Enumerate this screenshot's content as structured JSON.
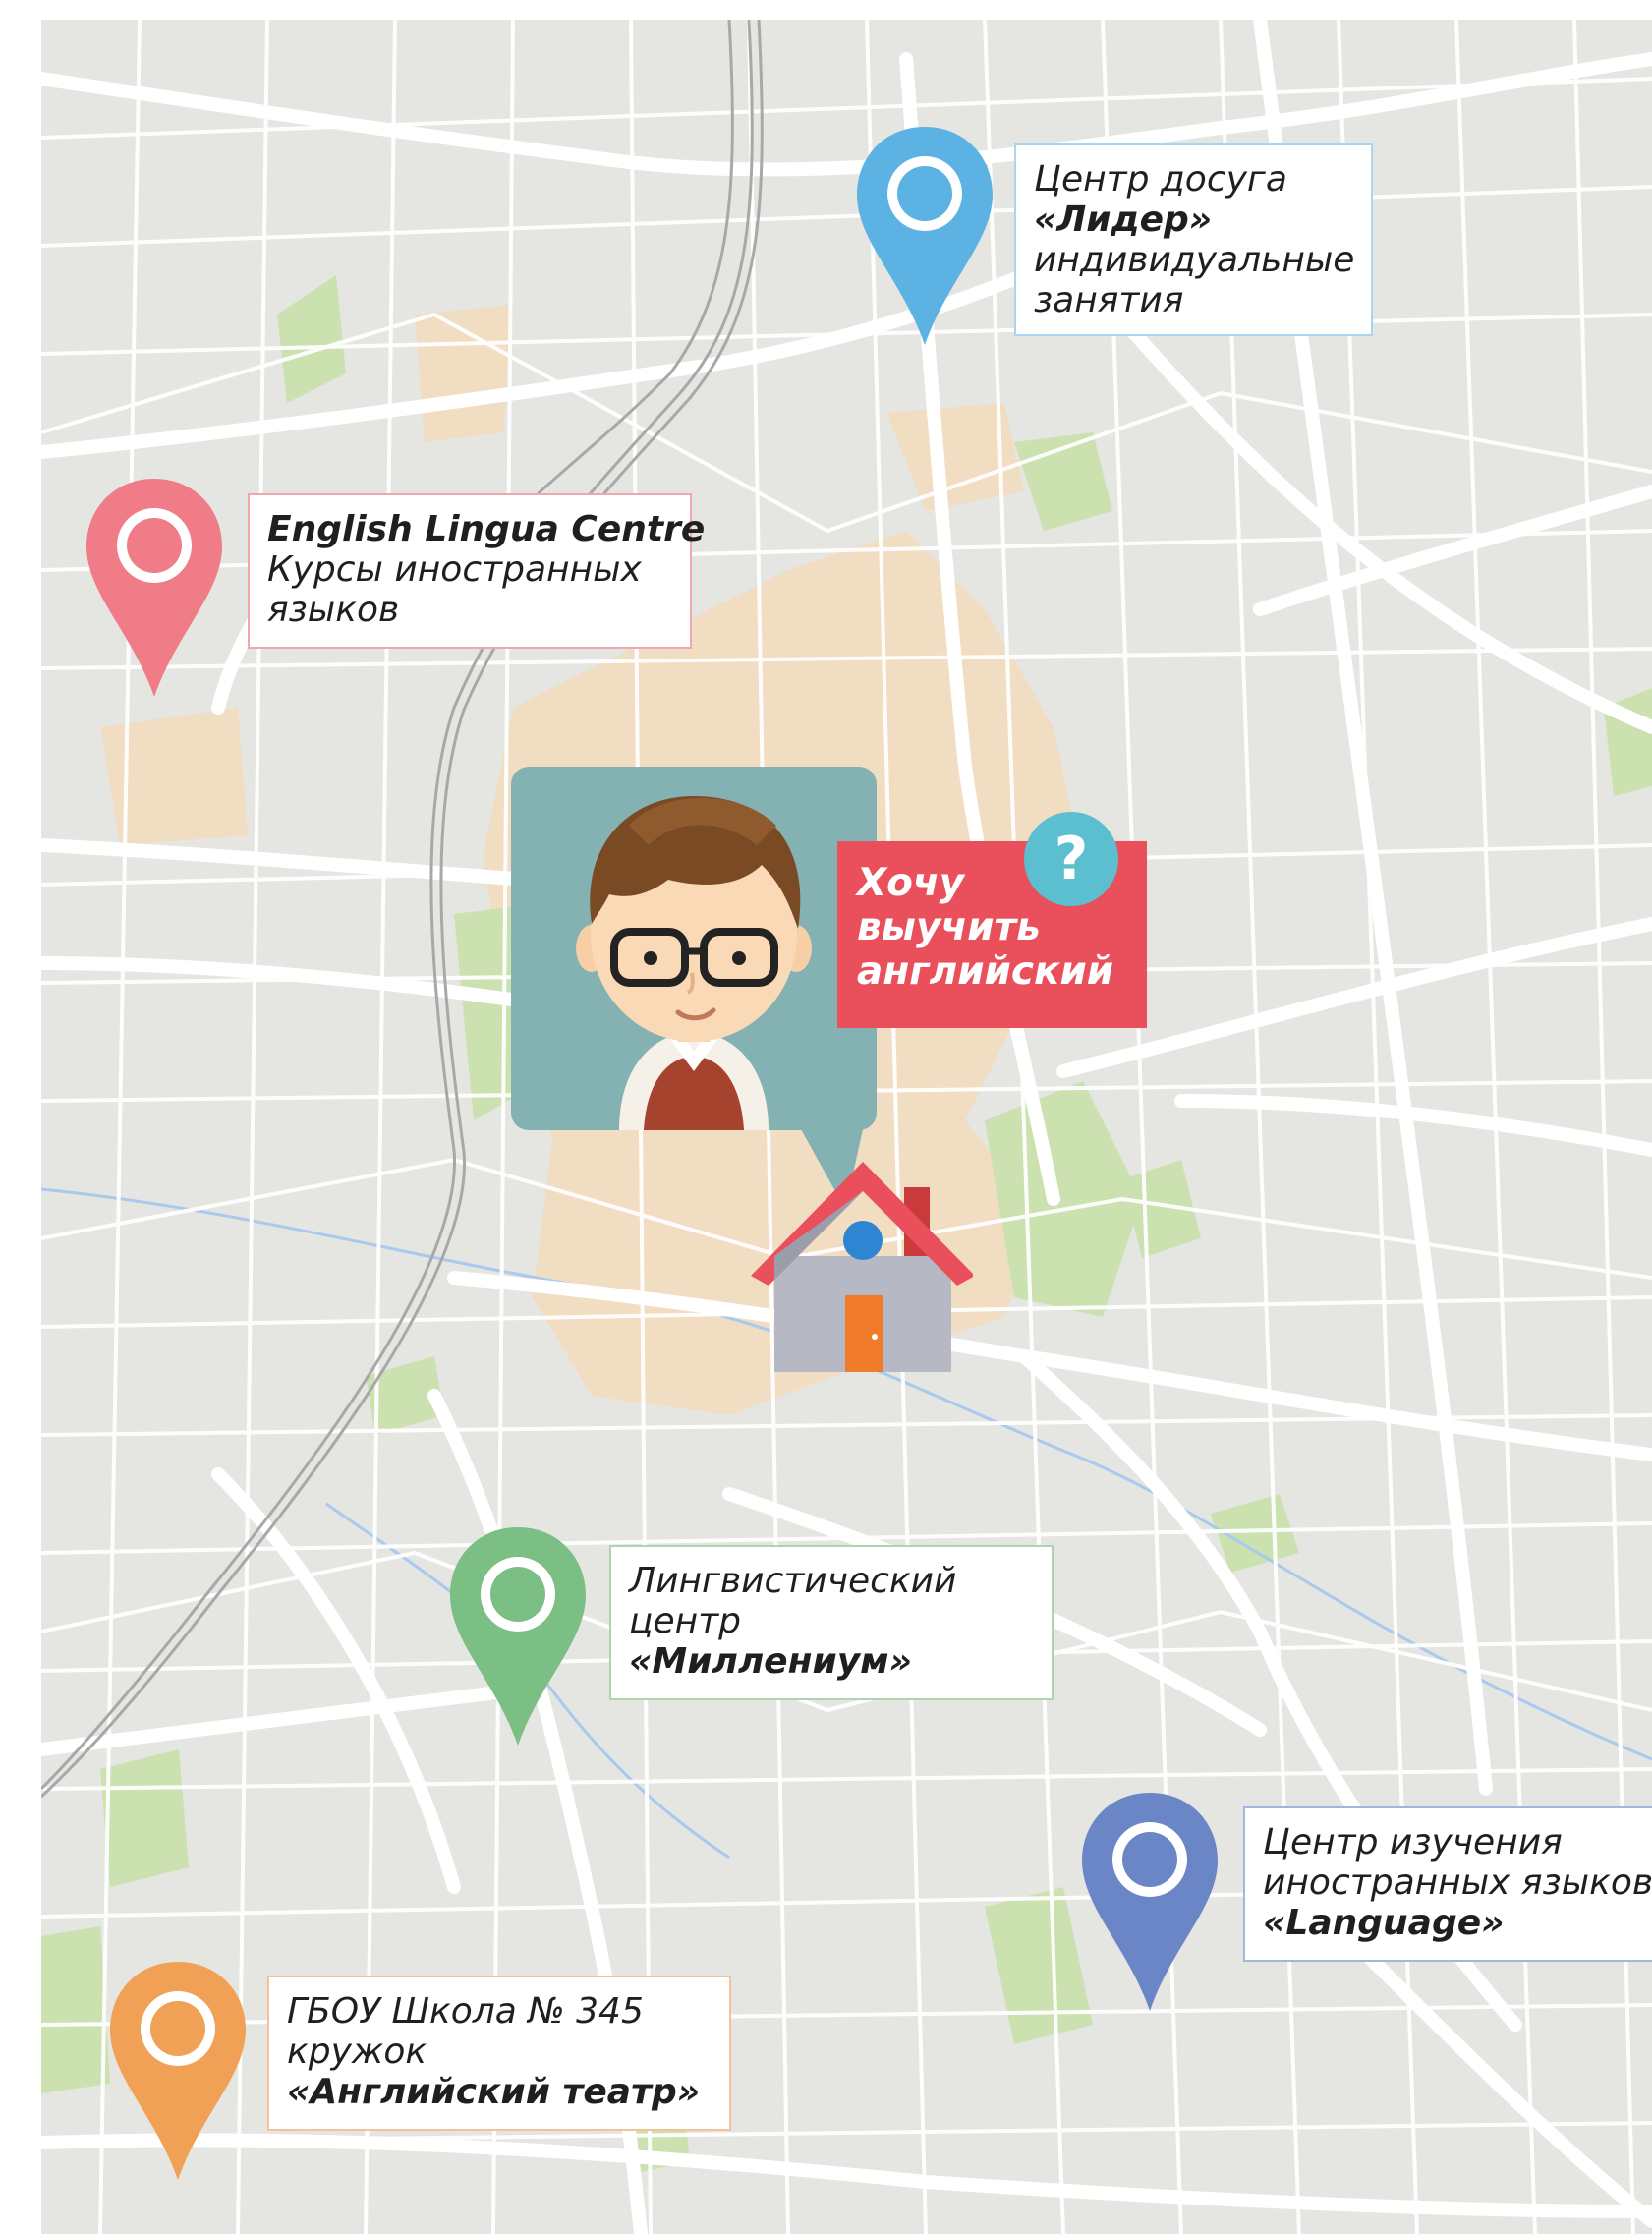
{
  "places": [
    {
      "id": "lider",
      "pin_color": "#5cb2e3",
      "border_color": "#a9d6ef",
      "lines": [
        {
          "text": "Центр досуга",
          "bold": false
        },
        {
          "text": "«Лидер»",
          "bold": true
        },
        {
          "text": "индивидуальные",
          "bold": false
        },
        {
          "text": "занятия",
          "bold": false
        }
      ]
    },
    {
      "id": "english-lingua",
      "pin_color": "#ef7c86",
      "border_color": "#efa9ae",
      "lines": [
        {
          "text": "English Lingua Centre",
          "bold": true
        },
        {
          "text": "Курсы иностранных",
          "bold": false
        },
        {
          "text": "языков",
          "bold": false
        }
      ]
    },
    {
      "id": "millenium",
      "pin_color": "#7bbf84",
      "border_color": "#a9d6ae",
      "lines": [
        {
          "text": "Лингвистический",
          "bold": false
        },
        {
          "text": "центр",
          "bold": false
        },
        {
          "text": "«Миллениум»",
          "bold": true
        }
      ]
    },
    {
      "id": "language",
      "pin_color": "#6b86c6",
      "border_color": "#a3b4de",
      "lines": [
        {
          "text": "Центр изучения",
          "bold": false
        },
        {
          "text": "иностранных языков",
          "bold": false
        },
        {
          "text": "«Language»",
          "bold": true
        }
      ]
    },
    {
      "id": "school-345",
      "pin_color": "#f0a155",
      "border_color": "#f3c397",
      "lines": [
        {
          "text": "ГБОУ Школа № 345",
          "bold": false
        },
        {
          "text": "кружок",
          "bold": false
        },
        {
          "text": "«Английский театр»",
          "bold": true
        }
      ]
    }
  ],
  "thought": {
    "lines": [
      "Хочу",
      "выучить",
      "английский"
    ],
    "question": "?",
    "color": "#e9505b"
  },
  "colors": {
    "map_bg": "#e5e5e2",
    "road": "#ffffff",
    "park": "#cbe2b0",
    "sand": "#f1ddc2",
    "avatar_bg": "#84b1b1",
    "water": "#a9c9ee",
    "rail": "#a8a8a8"
  },
  "icons": {
    "avatar": "student-avatar-icon",
    "home": "house-icon",
    "pin": "location-pin-icon"
  }
}
